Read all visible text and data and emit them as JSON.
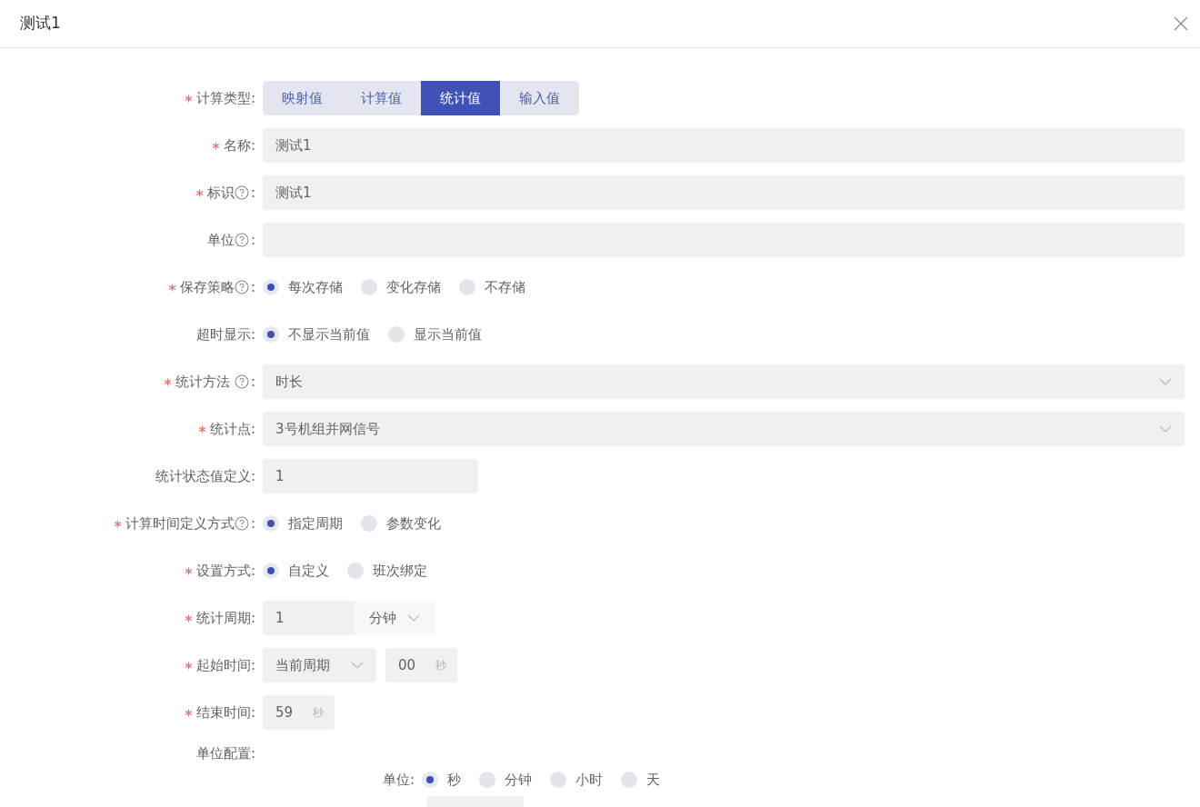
{
  "dialog": {
    "title": "测试1"
  },
  "form": [
    {
      "kind": "segmented",
      "label": "计算类型:",
      "required": true,
      "help": false,
      "options": [
        {
          "label": "映射值",
          "selected": false
        },
        {
          "label": "计算值",
          "selected": false
        },
        {
          "label": "统计值",
          "selected": true
        },
        {
          "label": "输入值",
          "selected": false
        }
      ]
    },
    {
      "kind": "input",
      "label": "名称:",
      "required": true,
      "help": false,
      "value": "测试1"
    },
    {
      "kind": "input",
      "label": "标识",
      "colon": ":",
      "required": true,
      "help": true,
      "value": "测试1"
    },
    {
      "kind": "input",
      "label": "单位",
      "colon": ":",
      "required": false,
      "help": true
    },
    {
      "kind": "radio",
      "label": "保存策略",
      "colon": ":",
      "required": true,
      "help": true,
      "options": [
        {
          "label": "每次存储",
          "selected": true
        },
        {
          "label": "变化存储",
          "selected": false
        },
        {
          "label": "不存储",
          "selected": false
        }
      ]
    },
    {
      "kind": "radio",
      "label": "超时显示:",
      "required": false,
      "help": false,
      "options": [
        {
          "label": "不显示当前值",
          "selected": true
        },
        {
          "label": "显示当前值",
          "selected": false
        }
      ]
    },
    {
      "kind": "select",
      "label": "统计方法 ",
      "colon": ":",
      "required": true,
      "help": true,
      "value": "时长"
    },
    {
      "kind": "select",
      "label": "统计点:",
      "required": true,
      "help": false,
      "value": "3号机组并网信号"
    },
    {
      "kind": "short_input",
      "label": "统计状态值定义:",
      "required": false,
      "help": false,
      "value": "1"
    },
    {
      "kind": "radio",
      "label": "计算时间定义方式",
      "colon": ":",
      "required": true,
      "help": true,
      "options": [
        {
          "label": "指定周期",
          "selected": true
        },
        {
          "label": "参数变化",
          "selected": false
        }
      ]
    },
    {
      "kind": "radio",
      "label": "设置方式:",
      "required": true,
      "help": false,
      "options": [
        {
          "label": "自定义",
          "selected": true
        },
        {
          "label": "班次绑定",
          "selected": false
        }
      ]
    },
    {
      "kind": "period",
      "label": "统计周期:",
      "required": true,
      "help": false,
      "value": "1",
      "unit": "分钟"
    },
    {
      "kind": "start",
      "label": "起始时间:",
      "required": true,
      "help": false,
      "select": "当前周期",
      "value": "00",
      "suffix": "秒"
    },
    {
      "kind": "end",
      "label": "结束时间:",
      "required": true,
      "help": false,
      "value": "59",
      "suffix": "秒"
    },
    {
      "kind": "unit_config",
      "label": "单位配置:",
      "required": false,
      "help": false,
      "sub_label": "单位:",
      "options": [
        {
          "label": "秒",
          "selected": true
        },
        {
          "label": "分钟",
          "selected": false
        },
        {
          "label": "小时",
          "selected": false
        },
        {
          "label": "天",
          "selected": false
        }
      ]
    }
  ]
}
